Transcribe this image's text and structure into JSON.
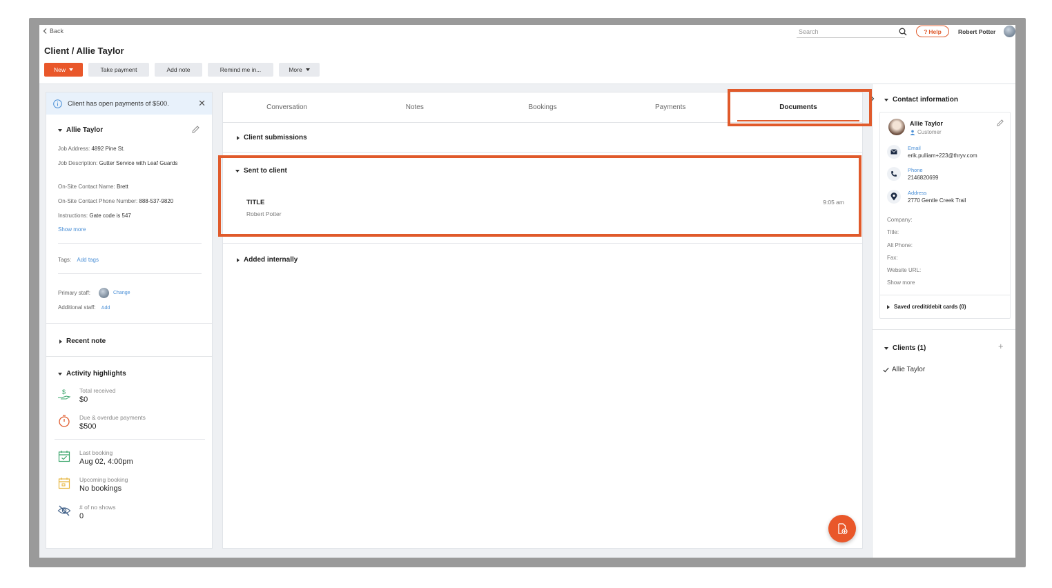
{
  "topbar": {
    "back_label": "Back",
    "search_placeholder": "Search",
    "help_label": "Help",
    "user_name": "Robert Potter"
  },
  "page": {
    "title": "Client / Allie Taylor"
  },
  "actions": {
    "new_label": "New",
    "take_payment_label": "Take payment",
    "add_note_label": "Add note",
    "remind_label": "Remind me in...",
    "more_label": "More"
  },
  "left": {
    "alert_text": "Client has open payments of $500.",
    "client_name": "Allie Taylor",
    "job_address_label": "Job Address:",
    "job_address": "4892 Pine St.",
    "job_description_label": "Job Description:",
    "job_description": "Gutter Service with Leaf Guards",
    "contact_name_label": "On-Site Contact Name:",
    "contact_name": "Brett",
    "contact_phone_label": "On-Site Contact Phone Number:",
    "contact_phone": "888-537-9820",
    "instructions_label": "Instructions:",
    "instructions": "Gate code is 547",
    "show_more": "Show more",
    "tags_label": "Tags:",
    "add_tags": "Add tags",
    "primary_staff_label": "Primary staff:",
    "change_label": "Change",
    "additional_staff_label": "Additional staff:",
    "add_label": "Add",
    "recent_note": "Recent note",
    "activity_title": "Activity highlights",
    "stats": [
      {
        "label": "Total received",
        "value": "$0",
        "color": "#3aa56b"
      },
      {
        "label": "Due & overdue payments",
        "value": "$500",
        "color": "#e05a2b"
      },
      {
        "label": "Last booking",
        "value": "Aug 02, 4:00pm",
        "color": "#3aa56b"
      },
      {
        "label": "Upcoming booking",
        "value": "No bookings",
        "color": "#e7b53c"
      },
      {
        "label": "# of no shows",
        "value": "0",
        "color": "#3f5f87"
      }
    ]
  },
  "center": {
    "tabs": [
      "Conversation",
      "Notes",
      "Bookings",
      "Payments",
      "Documents"
    ],
    "active_tab": "Documents",
    "client_submissions": "Client submissions",
    "sent_to_client": "Sent to client",
    "doc_title": "TITLE",
    "doc_author": "Robert Potter",
    "doc_time": "9:05 am",
    "added_internally": "Added internally"
  },
  "right": {
    "contact_information": "Contact information",
    "name": "Allie Taylor",
    "role": "Customer",
    "email_label": "Email",
    "email": "erik.pulliam+223@thryv.com",
    "phone_label": "Phone",
    "phone": "2146820699",
    "address_label": "Address",
    "address": "2770 Gentle Creek Trail",
    "company_label": "Company:",
    "title_label": "Title:",
    "alt_phone_label": "Alt Phone:",
    "fax_label": "Fax:",
    "website_label": "Website URL:",
    "show_more": "Show more",
    "saved_cards": "Saved credit/debit cards (0)",
    "clients_title": "Clients (1)",
    "client_item": "Allie Taylor"
  },
  "colors": {
    "accent": "#e9572a",
    "highlight": "#e05a2b",
    "link": "#4a8fd6"
  }
}
